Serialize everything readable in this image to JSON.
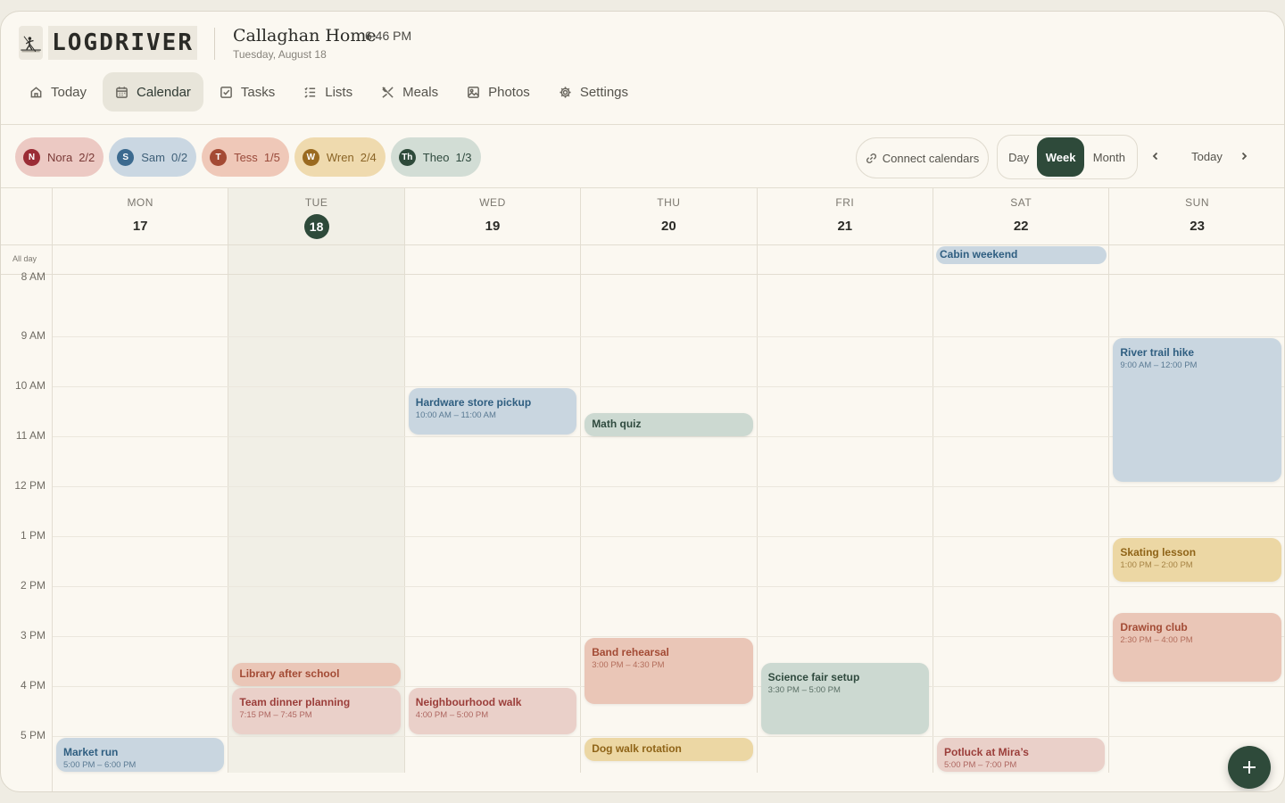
{
  "brand": {
    "name": "LOGDRIVER"
  },
  "home": {
    "title": "Callaghan Home",
    "time": "6:46 PM",
    "date": "Tuesday, August 18"
  },
  "nav": [
    {
      "label": "Today",
      "icon": "home-icon"
    },
    {
      "label": "Calendar",
      "icon": "calendar-icon",
      "active": true
    },
    {
      "label": "Tasks",
      "icon": "checkbox-icon"
    },
    {
      "label": "Lists",
      "icon": "list-icon"
    },
    {
      "label": "Meals",
      "icon": "utensils-icon"
    },
    {
      "label": "Photos",
      "icon": "image-icon"
    },
    {
      "label": "Settings",
      "icon": "gear-icon"
    }
  ],
  "members": [
    {
      "initial": "N",
      "name": "Nora",
      "count": "2/2",
      "bg": "#ecc9c3",
      "avatar": "#9b2c35",
      "text": "#7a3a37"
    },
    {
      "initial": "S",
      "name": "Sam",
      "count": "0/2",
      "bg": "#cad7e2",
      "avatar": "#3c6a8f",
      "text": "#3e5f78"
    },
    {
      "initial": "T",
      "name": "Tess",
      "count": "1/5",
      "bg": "#efc8b8",
      "avatar": "#a44a34",
      "text": "#9a4a3a"
    },
    {
      "initial": "W",
      "name": "Wren",
      "count": "2/4",
      "bg": "#efdaae",
      "avatar": "#9a6a20",
      "text": "#8a6426"
    },
    {
      "initial": "Th",
      "name": "Theo",
      "count": "1/3",
      "bg": "#d2ddd5",
      "avatar": "#2e4a3a",
      "text": "#2f4a3e"
    }
  ],
  "toolbar": {
    "connect_label": "Connect calendars",
    "views": [
      "Day",
      "Week",
      "Month"
    ],
    "active_view": "Week",
    "today_label": "Today"
  },
  "week": {
    "days": [
      {
        "name": "MON",
        "num": "17"
      },
      {
        "name": "TUE",
        "num": "18",
        "today": true
      },
      {
        "name": "WED",
        "num": "19"
      },
      {
        "name": "THU",
        "num": "20"
      },
      {
        "name": "FRI",
        "num": "21"
      },
      {
        "name": "SAT",
        "num": "22"
      },
      {
        "name": "SUN",
        "num": "23"
      }
    ],
    "allday_label": "All day",
    "hours": [
      "8 AM",
      "9 AM",
      "10 AM",
      "11 AM",
      "12 PM",
      "1 PM",
      "2 PM",
      "3 PM",
      "4 PM",
      "5 PM"
    ]
  },
  "allday_events": [
    {
      "day": 5,
      "title": "Cabin weekend"
    }
  ],
  "events": [
    {
      "day": 0,
      "title": "Market run",
      "time": "5:00 PM – 6:00 PM",
      "color": "blue",
      "start": 17.0,
      "end": 18.0
    },
    {
      "day": 1,
      "title": "Library after school",
      "time": "",
      "color": "peach",
      "start": 15.5,
      "end": 16.0
    },
    {
      "day": 1,
      "title": "Team dinner planning",
      "time": "7:15 PM – 7:45 PM",
      "color": "rose",
      "start": 16.0,
      "end": 17.0
    },
    {
      "day": 2,
      "title": "Hardware store pickup",
      "time": "10:00 AM – 11:00 AM",
      "color": "blue",
      "start": 10.0,
      "end": 11.0
    },
    {
      "day": 2,
      "title": "Neighbourhood walk",
      "time": "4:00 PM – 5:00 PM",
      "color": "rose",
      "start": 16.0,
      "end": 17.0
    },
    {
      "day": 3,
      "title": "Math quiz",
      "time": "",
      "color": "green",
      "start": 10.5,
      "end": 11.0
    },
    {
      "day": 3,
      "title": "Band rehearsal",
      "time": "3:00 PM – 4:30 PM",
      "color": "peach",
      "start": 15.0,
      "end": 16.4
    },
    {
      "day": 3,
      "title": "Dog walk rotation",
      "time": "",
      "color": "yellow",
      "start": 17.0,
      "end": 17.5
    },
    {
      "day": 4,
      "title": "Science fair setup",
      "time": "3:30 PM – 5:00 PM",
      "color": "green",
      "start": 15.5,
      "end": 17.0
    },
    {
      "day": 5,
      "title": "Potluck at Mira’s",
      "time": "5:00 PM – 7:00 PM",
      "color": "rose",
      "start": 17.0,
      "end": 18.0
    },
    {
      "day": 6,
      "title": "River trail hike",
      "time": "9:00 AM – 12:00 PM",
      "color": "blue",
      "start": 9.0,
      "end": 11.95
    },
    {
      "day": 6,
      "title": "Skating lesson",
      "time": "1:00 PM – 2:00 PM",
      "color": "yellow",
      "start": 13.0,
      "end": 13.95
    },
    {
      "day": 6,
      "title": "Drawing club",
      "time": "2:30 PM – 4:00 PM",
      "color": "peach",
      "start": 14.5,
      "end": 15.95
    }
  ]
}
